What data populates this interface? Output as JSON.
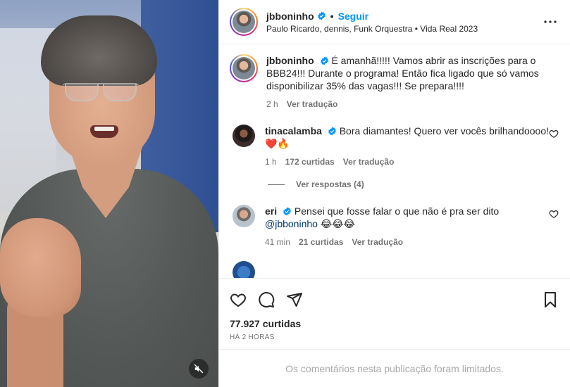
{
  "post": {
    "username": "jbboninho",
    "follow_label": "Seguir",
    "audio": "Paulo Ricardo, dennis, Funk Orquestra • Vida Real 2023"
  },
  "caption": {
    "username": "jbboninho",
    "text": "É amanhã!!!!! Vamos abrir as inscrições para o BBB24!!! Durante o programa! Então fica ligado que só vamos disponibilizar 35% das vagas!!! Se prepara!!!!",
    "time": "2 h",
    "translate": "Ver tradução"
  },
  "comments": [
    {
      "username": "tinacalamba",
      "text": "Bora diamantes! Quero ver vocês brilhandoooo! ❤️🔥",
      "time": "1 h",
      "likes": "172 curtidas",
      "translate": "Ver tradução",
      "replies": "Ver respostas (4)"
    },
    {
      "username": "eri",
      "text": "Pensei que fosse falar o que não é pra ser dito",
      "mention": "@jbboninho",
      "emojis": " 😂😂😂",
      "time": "41 min",
      "likes": "21 curtidas",
      "translate": "Ver tradução"
    }
  ],
  "footer": {
    "likes": "77.927 curtidas",
    "time": "HÁ 2 HORAS",
    "limited": "Os comentários nesta publicação foram limitados."
  },
  "colors": {
    "verified": "#0095f6",
    "follow": "#0095f6"
  },
  "icons": [
    "verified-icon",
    "more-options-icon",
    "heart-icon",
    "comment-icon",
    "share-icon",
    "bookmark-icon",
    "mute-icon"
  ]
}
